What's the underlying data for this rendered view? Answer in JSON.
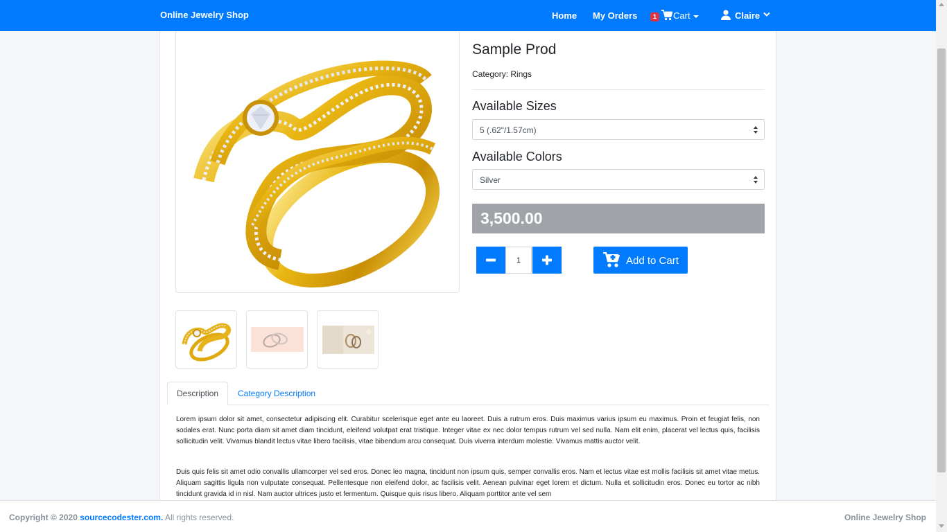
{
  "navbar": {
    "brand": "Online Jewelry Shop",
    "home": "Home",
    "my_orders": "My Orders",
    "cart_count": "1",
    "cart": "Cart",
    "user": "Claire"
  },
  "product": {
    "name": "Sample Prod",
    "category_label": "Category:",
    "category": "Rings",
    "sizes_label": "Available Sizes",
    "size_selected": "5 (.62\"/1.57cm)",
    "colors_label": "Available Colors",
    "color_selected": "Silver",
    "price": "3,500.00",
    "quantity": "1",
    "add_to_cart": "Add to Cart"
  },
  "tabs": {
    "description": "Description",
    "category_description": "Category Description"
  },
  "description": {
    "p1": "Lorem ipsum dolor sit amet, consectetur adipiscing elit. Curabitur scelerisque eget ante eu laoreet. Duis a rutrum eros. Duis maximus varius ipsum eu maximus. Proin et feugiat felis, non sodales erat. Nunc porta diam sit amet diam tincidunt, eleifend volutpat erat tristique. Integer vitae ex nec dolor tempus rutrum vel sed nulla. Nam elit enim, placerat vel lectus quis, facilisis sollicitudin velit. Vivamus blandit lectus vitae libero facilisis, vitae bibendum arcu consequat. Duis viverra interdum molestie. Vivamus mattis auctor velit.",
    "p2": "Duis quis felis sit amet odio convallis ullamcorper vel sed eros. Donec leo magna, tincidunt non ipsum quis, semper convallis eros. Nam et lectus vitae est mollis facilisis sit amet vitae metus. Aliquam sagittis ligula non vulputate consequat. Pellentesque non eleifend dolor, ac facilisis velit. Aenean pulvinar eget lorem et dictum. Nulla et sollicitudin eros. Donec eu tortor ac nibh tincidunt gravida id in nisl. Nam auctor ultrices justo et fermentum. Quisque quis risus libero. Aliquam porttitor ante vel sem"
  },
  "footer": {
    "copyright_prefix": "Copyright © 2020",
    "site": "sourcecodester.com.",
    "rights": "All rights reserved.",
    "brand": "Online Jewelry Shop"
  },
  "colors": {
    "primary": "#007bff",
    "price_bg": "#a0a4a9",
    "badge": "#dc3545"
  },
  "icons": [
    "shopping-cart-icon",
    "user-icon",
    "chevron-down-icon",
    "minus-icon",
    "plus-icon",
    "cart-plus-icon",
    "select-arrows-icon"
  ]
}
